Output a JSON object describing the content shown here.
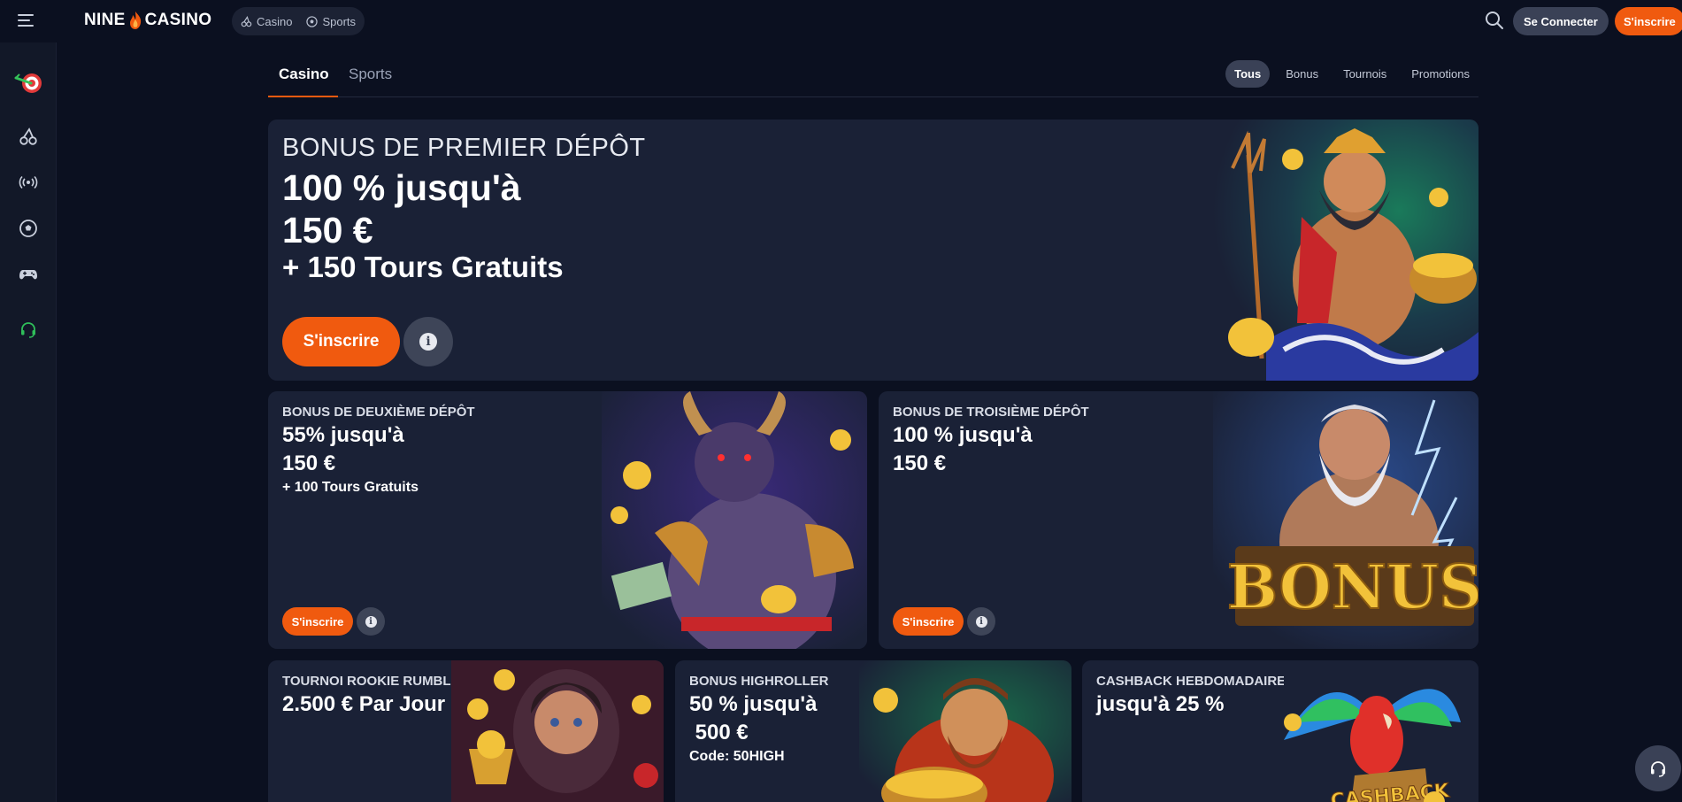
{
  "header": {
    "logo_left": "NINE",
    "logo_right": "CASINO",
    "nav": [
      {
        "label": "Casino",
        "icon": "cherry-icon"
      },
      {
        "label": "Sports",
        "icon": "soccer-ball-icon"
      }
    ],
    "login_label": "Se Connecter",
    "signup_label": "S'inscrire"
  },
  "sidebar": {
    "items": [
      {
        "icon": "target-icon"
      },
      {
        "icon": "cherry-icon"
      },
      {
        "icon": "live-icon"
      },
      {
        "icon": "soccer-ball-icon"
      },
      {
        "icon": "gamepad-icon"
      },
      {
        "icon": "headset-icon"
      }
    ]
  },
  "tabs": {
    "main": [
      "Casino",
      "Sports"
    ],
    "filters": [
      "Tous",
      "Bonus",
      "Tournois",
      "Promotions"
    ],
    "active_filter": "Tous"
  },
  "promos": {
    "first": {
      "label": "BONUS DE PREMIER DÉPÔT",
      "line1": "100 % jusqu'à",
      "line2": "150 €",
      "line3": "+ 150 Tours Gratuits",
      "cta": "S'inscrire"
    },
    "second": {
      "label": "BONUS DE DEUXIÈME DÉPÔT",
      "line1": "55% jusqu'à",
      "line2": "150 €",
      "line3": "+ 100 Tours Gratuits",
      "cta": "S'inscrire"
    },
    "third": {
      "label": "BONUS DE TROISIÈME DÉPÔT",
      "line1": "100 % jusqu'à",
      "line2": "150 €",
      "cta": "S'inscrire",
      "art_text": "BONUS"
    },
    "rookie": {
      "label": "TOURNOI ROOKIE RUMBLE",
      "line1": "2.500 € Par Jour"
    },
    "highroller": {
      "label": "BONUS HIGHROLLER",
      "line1": "50 % jusqu'à",
      "line2": " 500 €",
      "line3": "Code: 50HIGH"
    },
    "cashback": {
      "label": "CASHBACK HEBDOMADAIRE",
      "line1": "jusqu'à 25 %",
      "art_text": "CASHBACK"
    }
  },
  "colors": {
    "accent": "#f05a0f",
    "background": "#0b1020",
    "card": "#1a2136"
  }
}
